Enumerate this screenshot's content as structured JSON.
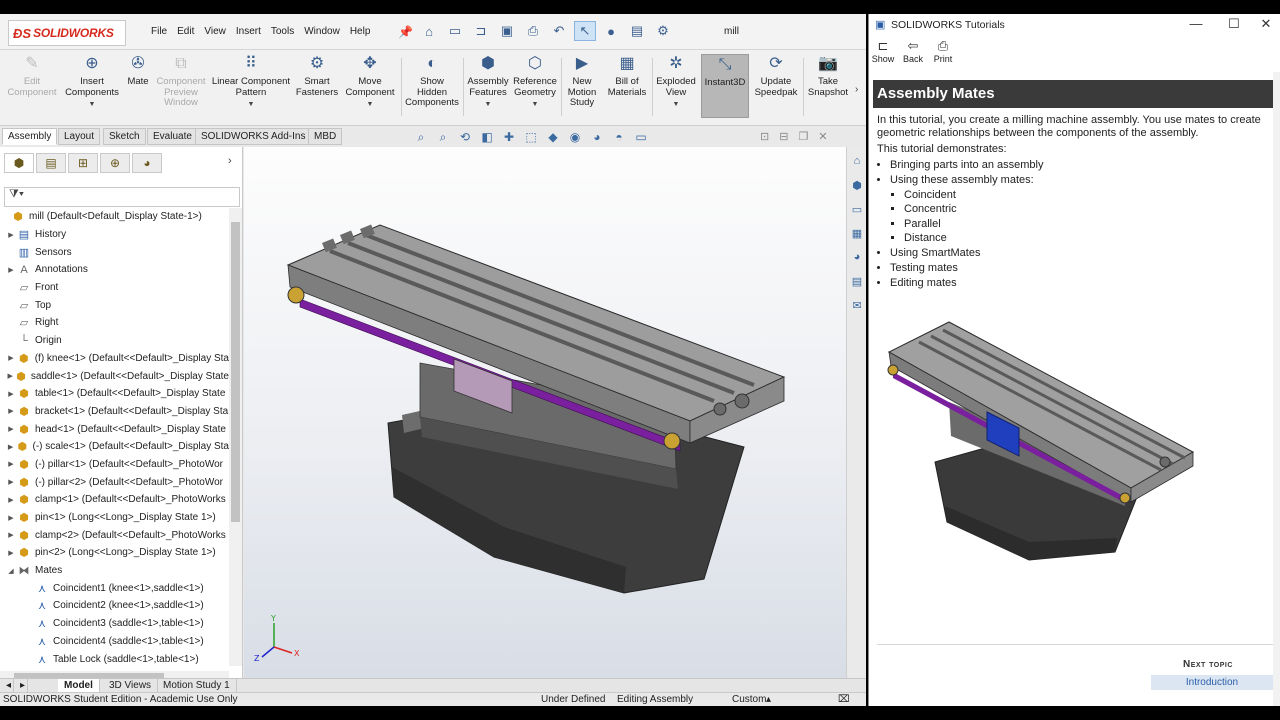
{
  "app": {
    "brand": "SOLIDWORKS",
    "menu": [
      "File",
      "Edit",
      "View",
      "Insert",
      "Tools",
      "Window",
      "Help"
    ],
    "document_name": "mill"
  },
  "ribbon": {
    "buttons": [
      {
        "label": "Edit Component",
        "icon": "edit-component-icon",
        "disabled": true
      },
      {
        "label": "Insert Components",
        "icon": "insert-components-icon",
        "disabled": false
      },
      {
        "label": "Mate",
        "icon": "mate-icon",
        "disabled": false
      },
      {
        "label": "Component Preview Window",
        "icon": "preview-window-icon",
        "disabled": true
      },
      {
        "label": "Linear Component Pattern",
        "icon": "linear-pattern-icon",
        "disabled": false
      },
      {
        "label": "Smart Fasteners",
        "icon": "smart-fasteners-icon",
        "disabled": false
      },
      {
        "label": "Move Component",
        "icon": "move-component-icon",
        "disabled": false
      },
      {
        "label": "Show Hidden Components",
        "icon": "show-hidden-icon",
        "disabled": false
      },
      {
        "label": "Assembly Features",
        "icon": "assembly-features-icon",
        "disabled": false
      },
      {
        "label": "Reference Geometry",
        "icon": "reference-geometry-icon",
        "disabled": false
      },
      {
        "label": "New Motion Study",
        "icon": "motion-study-icon",
        "disabled": false
      },
      {
        "label": "Bill of Materials",
        "icon": "bom-icon",
        "disabled": false
      },
      {
        "label": "Exploded View",
        "icon": "exploded-view-icon",
        "disabled": false
      },
      {
        "label": "Instant3D",
        "icon": "instant3d-icon",
        "disabled": false,
        "active": true
      },
      {
        "label": "Update Speedpak",
        "icon": "speedpak-icon",
        "disabled": false
      },
      {
        "label": "Take Snapshot",
        "icon": "snapshot-icon",
        "disabled": false
      }
    ]
  },
  "command_tabs": [
    "Assembly",
    "Layout",
    "Sketch",
    "Evaluate",
    "SOLIDWORKS Add-Ins",
    "MBD"
  ],
  "feature_tree": {
    "root": "mill  (Default<Default_Display State-1>)",
    "items": [
      {
        "label": "History",
        "icon": "history-icon"
      },
      {
        "label": "Sensors",
        "icon": "sensors-icon"
      },
      {
        "label": "Annotations",
        "icon": "annotations-icon"
      },
      {
        "label": "Front",
        "icon": "plane-icon"
      },
      {
        "label": "Top",
        "icon": "plane-icon"
      },
      {
        "label": "Right",
        "icon": "plane-icon"
      },
      {
        "label": "Origin",
        "icon": "origin-icon"
      },
      {
        "label": "(f) knee<1> (Default<<Default>_Display Sta",
        "icon": "part-icon"
      },
      {
        "label": "saddle<1> (Default<<Default>_Display State",
        "icon": "part-icon"
      },
      {
        "label": "table<1> (Default<<Default>_Display State",
        "icon": "part-icon"
      },
      {
        "label": "bracket<1> (Default<<Default>_Display Sta",
        "icon": "part-icon"
      },
      {
        "label": "head<1> (Default<<Default>_Display State",
        "icon": "part-icon"
      },
      {
        "label": "(-) scale<1> (Default<<Default>_Display Sta",
        "icon": "part-icon"
      },
      {
        "label": "(-) pillar<1> (Default<<Default>_PhotoWor",
        "icon": "part-icon"
      },
      {
        "label": "(-) pillar<2> (Default<<Default>_PhotoWor",
        "icon": "part-icon"
      },
      {
        "label": "clamp<1> (Default<<Default>_PhotoWorks",
        "icon": "part-icon"
      },
      {
        "label": "pin<1> (Long<<Long>_Display State 1>)",
        "icon": "part-icon"
      },
      {
        "label": "clamp<2> (Default<<Default>_PhotoWorks",
        "icon": "part-icon"
      },
      {
        "label": "pin<2> (Long<<Long>_Display State 1>)",
        "icon": "part-icon"
      },
      {
        "label": "Mates",
        "icon": "mates-folder-icon"
      },
      {
        "label": "Coincident1 (knee<1>,saddle<1>)",
        "icon": "coincident-mate-icon"
      },
      {
        "label": "Coincident2 (knee<1>,saddle<1>)",
        "icon": "coincident-mate-icon"
      },
      {
        "label": "Coincident3 (saddle<1>,table<1>)",
        "icon": "coincident-mate-icon"
      },
      {
        "label": "Coincident4 (saddle<1>,table<1>)",
        "icon": "coincident-mate-icon"
      },
      {
        "label": "Table Lock (saddle<1>,table<1>)",
        "icon": "coincident-mate-icon"
      }
    ]
  },
  "bottom_tabs": [
    "Model",
    "3D Views",
    "Motion Study 1"
  ],
  "status": {
    "edition": "SOLIDWORKS Student Edition - Academic Use Only",
    "definition": "Under Defined",
    "mode": "Editing Assembly",
    "units": "Custom"
  },
  "tutorial": {
    "window_title": "SOLIDWORKS Tutorials",
    "tools": [
      "Show",
      "Back",
      "Print"
    ],
    "heading": "Assembly Mates",
    "intro": "In this tutorial, you create a milling machine assembly. You use mates to create geometric relationships between the components of the assembly.",
    "demonstrates": "This tutorial demonstrates:",
    "bullets": [
      "Bringing parts into an assembly",
      "Using these assembly mates:"
    ],
    "mates": [
      "Coincident",
      "Concentric",
      "Parallel",
      "Distance"
    ],
    "bullets2": [
      "Using SmartMates",
      "Testing mates",
      "Editing mates"
    ],
    "next_topic_label": "Next topic",
    "next_topic": "Introduction"
  },
  "colors": {
    "brand_red": "#d52b1e",
    "tutorial_header": "#3a3a3a",
    "scale_purple": "#7a1f9e"
  }
}
